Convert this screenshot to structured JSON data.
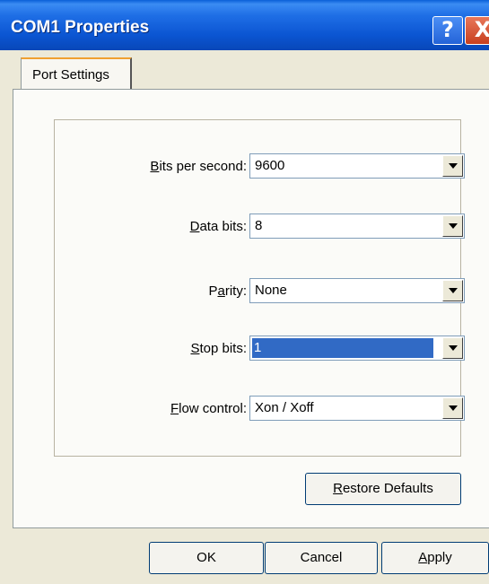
{
  "window": {
    "title": "COM1 Properties"
  },
  "title_buttons": {
    "help": "?",
    "close": "X"
  },
  "tabs": [
    {
      "label": "Port Settings"
    }
  ],
  "fields": {
    "bits_per_second": {
      "label_u": "B",
      "label_rest": "its per second:",
      "value": "9600"
    },
    "data_bits": {
      "label_u": "D",
      "label_rest": "ata bits:",
      "value": "8"
    },
    "parity": {
      "label_pre": "P",
      "label_u": "a",
      "label_rest": "rity:",
      "value": "None"
    },
    "stop_bits": {
      "label_u": "S",
      "label_rest": "top bits:",
      "value": "1"
    },
    "flow_control": {
      "label_u": "F",
      "label_rest": "low control:",
      "value": "Xon / Xoff"
    }
  },
  "buttons": {
    "restore_u": "R",
    "restore_rest": "estore Defaults",
    "ok": "OK",
    "cancel": "Cancel",
    "apply_u": "A",
    "apply_rest": "pply"
  }
}
